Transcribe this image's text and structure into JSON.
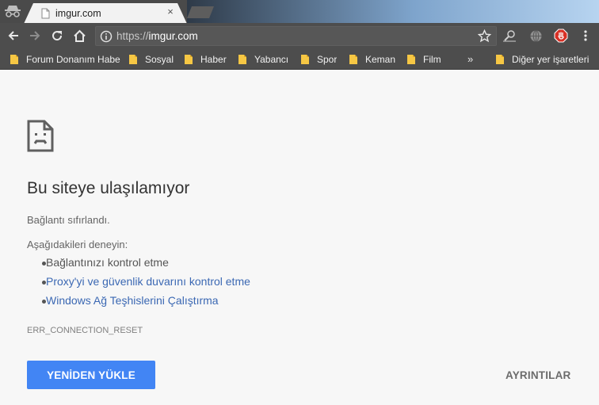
{
  "tab": {
    "title": "imgur.com",
    "close_glyph": "×"
  },
  "omnibox": {
    "scheme": "https://",
    "host": "imgur.com"
  },
  "bookmarks": {
    "items": [
      {
        "label": "Forum Donanım Habe"
      },
      {
        "label": "Sosyal"
      },
      {
        "label": "Haber"
      },
      {
        "label": "Yabancı"
      },
      {
        "label": "Spor"
      },
      {
        "label": "Keman"
      },
      {
        "label": "Film"
      }
    ],
    "overflow_glyph": "»",
    "other": "Diğer yer işaretleri"
  },
  "error": {
    "heading": "Bu siteye ulaşılamıyor",
    "message": "Bağlantı sıfırlandı.",
    "try_label": "Aşağıdakileri deneyin:",
    "suggestions": [
      "Bağlantınızı kontrol etme",
      "Proxy'yi ve güvenlik duvarını kontrol etme",
      "Windows Ağ Teşhislerini Çalıştırma"
    ],
    "code": "ERR_CONNECTION_RESET",
    "reload_button": "YENİDEN YÜKLE",
    "details_button": "AYRINTILAR"
  },
  "colors": {
    "accent": "#4285f4",
    "link": "#3b68b3",
    "toolbar": "#4d4d4d",
    "page_bg": "#f7f7f7"
  },
  "icons": [
    "incognito-icon",
    "page-icon",
    "close-icon",
    "back-icon",
    "forward-icon",
    "reload-icon",
    "home-icon",
    "info-icon",
    "star-icon",
    "search-extension-icon",
    "globe-icon",
    "adblock-icon",
    "menu-icon",
    "folder-icon",
    "sad-page-icon"
  ]
}
